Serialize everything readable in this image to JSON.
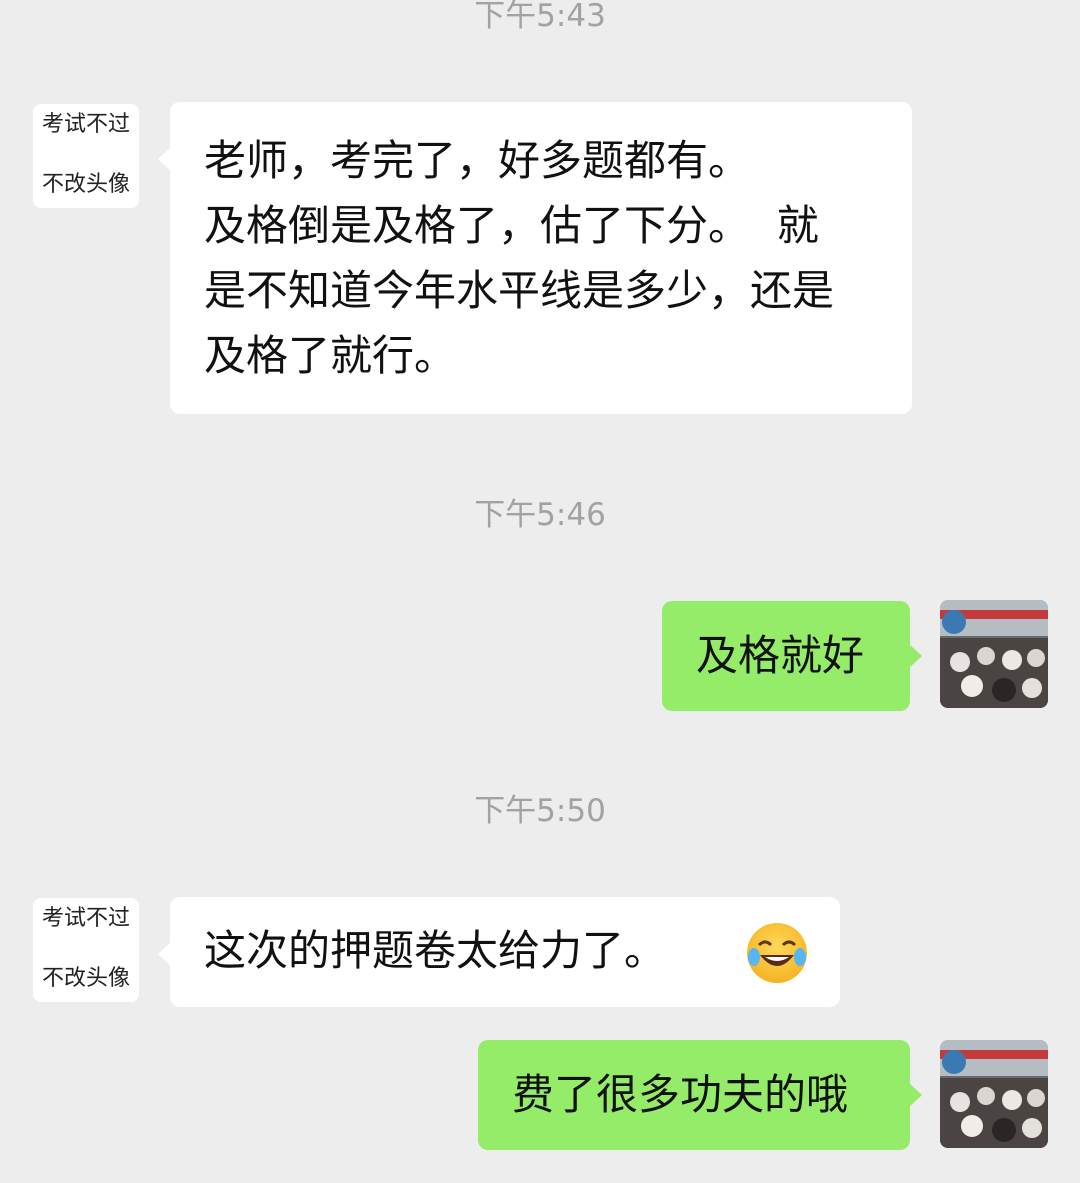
{
  "timestamps": [
    "下午5:43",
    "下午5:46",
    "下午5:50"
  ],
  "contact": {
    "avatar_line_1": "考试不过",
    "avatar_line_2": "不改头像"
  },
  "messages": [
    {
      "side": "left",
      "lines": [
        "老师，考完了，好多题都有。",
        "及格倒是及格了，估了下分。  就",
        "是不知道今年水平线是多少，还是",
        "及格了就行。"
      ]
    },
    {
      "side": "right",
      "text": "及格就好"
    },
    {
      "side": "left",
      "text": "这次的押题卷太给力了。",
      "emoji": "face-with-tears-of-joy-icon"
    },
    {
      "side": "right",
      "text": "费了很多功夫的哦"
    }
  ],
  "colors": {
    "background": "#ededed",
    "left_bubble": "#ffffff",
    "right_bubble": "#95ec69",
    "timestamp": "#a2a2a2"
  }
}
